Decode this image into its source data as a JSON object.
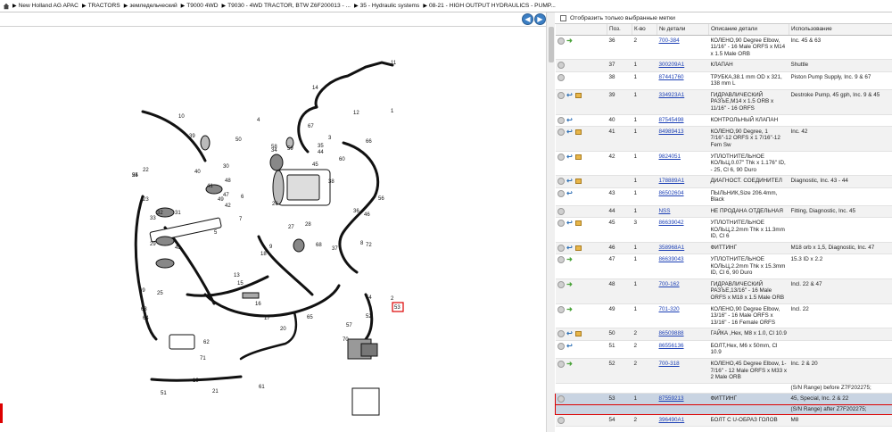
{
  "breadcrumb": [
    "New Holland AG APAC",
    "TRACTORS",
    "земледельческий",
    "T9000 4WD",
    "T9030 - 4WD TRACTOR, BTW Z6F200013 - ...",
    "35 - Hydraulic systems",
    "08-21 - HIGH OUTPUT HYDRAULICS - PUMP..."
  ],
  "nav": {
    "back": "◀",
    "forward": "▶"
  },
  "filter_label": "Отобразить только выбранные метки",
  "columns": [
    "Поз.",
    "К-во",
    "№ детали",
    "Описание детали",
    "Использование"
  ],
  "rows": [
    {
      "pos": "36",
      "qty": "2",
      "part": "700-384",
      "desc": "КОЛЕНО,90 Degree Elbow, 11/16\" - 16 Male ORFS x M14 x 1.5 Male ORB",
      "use": "Inc. 45 & 63",
      "icons": [
        "circle",
        "arrow"
      ]
    },
    {
      "pos": "37",
      "qty": "1",
      "part": "300209A1",
      "desc": "КЛАПАН",
      "use": "Shuttle",
      "icons": [
        "circle"
      ]
    },
    {
      "pos": "38",
      "qty": "1",
      "part": "87441760",
      "desc": "ТРУБКА,38.1 mm OD x 321, 138 mm L",
      "use": "Piston Pump Supply, Inc. 9 & 67",
      "icons": [
        "circle"
      ]
    },
    {
      "pos": "39",
      "qty": "1",
      "part": "334923A1",
      "desc": "ГИДРАВЛИЧЕСКИЙ РАЗЪЕ,M14 x 1.5 ORB x 11/16\" - 16 ORFS",
      "use": "Destroke Pump, 45 gph, Inc. 9 & 45",
      "icons": [
        "circle",
        "back",
        "box"
      ]
    },
    {
      "pos": "40",
      "qty": "1",
      "part": "87545498",
      "desc": "КОНТРОЛЬНЫЙ КЛАПАН",
      "use": "",
      "icons": [
        "circle",
        "back"
      ]
    },
    {
      "pos": "41",
      "qty": "1",
      "part": "84989413",
      "desc": "КОЛЕНО,90 Degree, 1 7/16\"-12 ORFS x 1 7/16\"-12 Fem Sw",
      "use": "Inc. 42",
      "icons": [
        "circle",
        "back",
        "box"
      ]
    },
    {
      "pos": "42",
      "qty": "1",
      "part": "9824051",
      "desc": "УПЛОТНИТЕЛЬНОЕ КОЛЬЦ,0.07\" Thk x 1.176\" ID, - 25, Cl 6, 90 Duro",
      "use": "",
      "icons": [
        "circle",
        "back",
        "box"
      ]
    },
    {
      "pos": "",
      "qty": "1",
      "part": "178889A1",
      "desc": "ДИАГНОСТ. СОЕДИНИТЕЛ",
      "use": "Diagnostic, Inc. 43 - 44",
      "icons": [
        "circle",
        "back",
        "box"
      ]
    },
    {
      "pos": "43",
      "qty": "1",
      "part": "86502604",
      "desc": "ПЫЛЬНИК,Size 206.4mm, Black",
      "use": "",
      "icons": [
        "circle",
        "back"
      ]
    },
    {
      "pos": "44",
      "qty": "1",
      "part": "NSS",
      "desc": "НЕ ПРОДАНА ОТДЕЛЬНАЯ",
      "use": "Fitting, Diagnostic, Inc. 45",
      "icons": [
        "circle"
      ]
    },
    {
      "pos": "45",
      "qty": "3",
      "part": "86639042",
      "desc": "УПЛОТНИТЕЛЬНОЕ КОЛЬЦ,2.2mm Thk x 11.3mm ID, Cl 6",
      "use": "",
      "icons": [
        "circle",
        "back",
        "box"
      ]
    },
    {
      "pos": "46",
      "qty": "1",
      "part": "358968A1",
      "desc": "ФИТТИНГ",
      "use": "M18 orb x 1,5, Diagnostic, Inc. 47",
      "icons": [
        "circle",
        "back",
        "box"
      ]
    },
    {
      "pos": "47",
      "qty": "1",
      "part": "86639043",
      "desc": "УПЛОТНИТЕЛЬНОЕ КОЛЬЦ,2.2mm Thk x 15.3mm ID, Cl 6, 90 Duro",
      "use": "15.3 ID x 2.2",
      "icons": [
        "circle",
        "arrow"
      ]
    },
    {
      "pos": "48",
      "qty": "1",
      "part": "700-162",
      "desc": "ГИДРАВЛИЧЕСКИЙ РАЗЪЕ,13/16\" - 16 Male ORFS x M18 x 1.5 Male ORB",
      "use": "Incl. 22 & 47",
      "icons": [
        "circle",
        "arrow"
      ]
    },
    {
      "pos": "49",
      "qty": "1",
      "part": "701-320",
      "desc": "КОЛЕНО,90 Degree Elbow, 13/16\" - 16 Male ORFS x 13/16\" - 16 Female ORFS",
      "use": "Incl. 22",
      "icons": [
        "circle",
        "arrow"
      ]
    },
    {
      "pos": "50",
      "qty": "2",
      "part": "86509888",
      "desc": "ГАЙКА ,Hex, M8 x 1.0, Cl 10.9",
      "use": "",
      "icons": [
        "circle",
        "back",
        "box"
      ]
    },
    {
      "pos": "51",
      "qty": "2",
      "part": "86556136",
      "desc": "БОЛТ,Hex, M6 x 50mm, Cl 10.9",
      "use": "",
      "icons": [
        "circle",
        "back"
      ]
    },
    {
      "pos": "52",
      "qty": "2",
      "part": "700-318",
      "desc": "КОЛЕНО,45 Degree Elbow, 1-7/16\" - 12 Male ORFS x M33 x 2 Male ORB",
      "use": "Inc. 2 & 20",
      "icons": [
        "circle",
        "arrow"
      ]
    },
    {
      "note": "(S/N Range) before Z7F202275;"
    },
    {
      "pos": "53",
      "qty": "1",
      "part": "87559213",
      "desc": "ФИТТИНГ",
      "use": "45, Special, Inc. 2 & 22",
      "icons": [
        "circle"
      ],
      "selected": true
    },
    {
      "note": "(S/N Range) after Z7F202275;",
      "selected": true
    },
    {
      "pos": "54",
      "qty": "2",
      "part": "396490A1",
      "desc": "БОЛТ С U-ОБРАЗ ГОЛОВ",
      "use": "M8",
      "icons": [
        "circle"
      ]
    }
  ],
  "callouts": [
    "1",
    "2",
    "3",
    "4",
    "5",
    "6",
    "7",
    "8",
    "9",
    "10",
    "11",
    "12",
    "13",
    "14",
    "15",
    "16",
    "17",
    "18",
    "19",
    "20",
    "21",
    "22",
    "23",
    "24",
    "25",
    "26",
    "27",
    "28",
    "29",
    "30",
    "31",
    "32",
    "33",
    "34",
    "35",
    "36",
    "37",
    "38",
    "39",
    "40",
    "41",
    "42",
    "43",
    "44",
    "45",
    "46",
    "47",
    "48",
    "49",
    "50",
    "51",
    "52",
    "53",
    "54",
    "55",
    "56",
    "57",
    "58",
    "59",
    "60",
    "61",
    "62",
    "63",
    "64",
    "65",
    "66",
    "67",
    "68",
    "69",
    "70",
    "71",
    "72"
  ],
  "highlighted_callout": "53"
}
